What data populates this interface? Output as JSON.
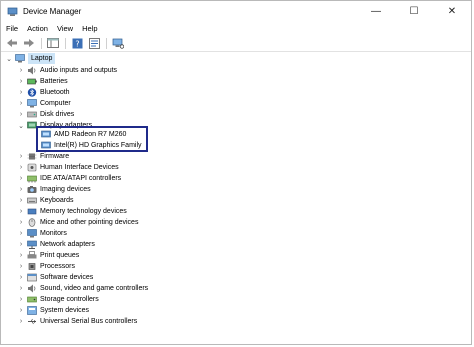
{
  "window": {
    "title": "Device Manager"
  },
  "menu": [
    "File",
    "Action",
    "View",
    "Help"
  ],
  "tree": {
    "root": "Laptop",
    "items": [
      {
        "label": "Audio inputs and outputs",
        "icon": "speaker-icon"
      },
      {
        "label": "Batteries",
        "icon": "battery-icon"
      },
      {
        "label": "Bluetooth",
        "icon": "bluetooth-icon"
      },
      {
        "label": "Computer",
        "icon": "computer-icon"
      },
      {
        "label": "Disk drives",
        "icon": "disk-icon"
      },
      {
        "label": "Display adapters",
        "icon": "display-adapter-icon",
        "expanded": true,
        "children": [
          {
            "label": "AMD Radeon R7 M260",
            "icon": "display-adapter-icon"
          },
          {
            "label": "Intel(R) HD Graphics Family",
            "icon": "display-adapter-icon"
          }
        ]
      },
      {
        "label": "Firmware",
        "icon": "chip-icon"
      },
      {
        "label": "Human Interface Devices",
        "icon": "hid-icon"
      },
      {
        "label": "IDE ATA/ATAPI controllers",
        "icon": "controller-icon"
      },
      {
        "label": "Imaging devices",
        "icon": "camera-icon"
      },
      {
        "label": "Keyboards",
        "icon": "keyboard-icon"
      },
      {
        "label": "Memory technology devices",
        "icon": "chip-icon"
      },
      {
        "label": "Mice and other pointing devices",
        "icon": "mouse-icon"
      },
      {
        "label": "Monitors",
        "icon": "monitor-icon"
      },
      {
        "label": "Network adapters",
        "icon": "network-icon"
      },
      {
        "label": "Print queues",
        "icon": "printer-icon"
      },
      {
        "label": "Processors",
        "icon": "processor-icon"
      },
      {
        "label": "Software devices",
        "icon": "software-icon"
      },
      {
        "label": "Sound, video and game controllers",
        "icon": "speaker-icon"
      },
      {
        "label": "Storage controllers",
        "icon": "storage-icon"
      },
      {
        "label": "System devices",
        "icon": "system-icon"
      },
      {
        "label": "Universal Serial Bus controllers",
        "icon": "usb-icon"
      }
    ]
  },
  "colors": {
    "highlight_border": "#1f2a8a",
    "selection": "#cce4f7"
  }
}
